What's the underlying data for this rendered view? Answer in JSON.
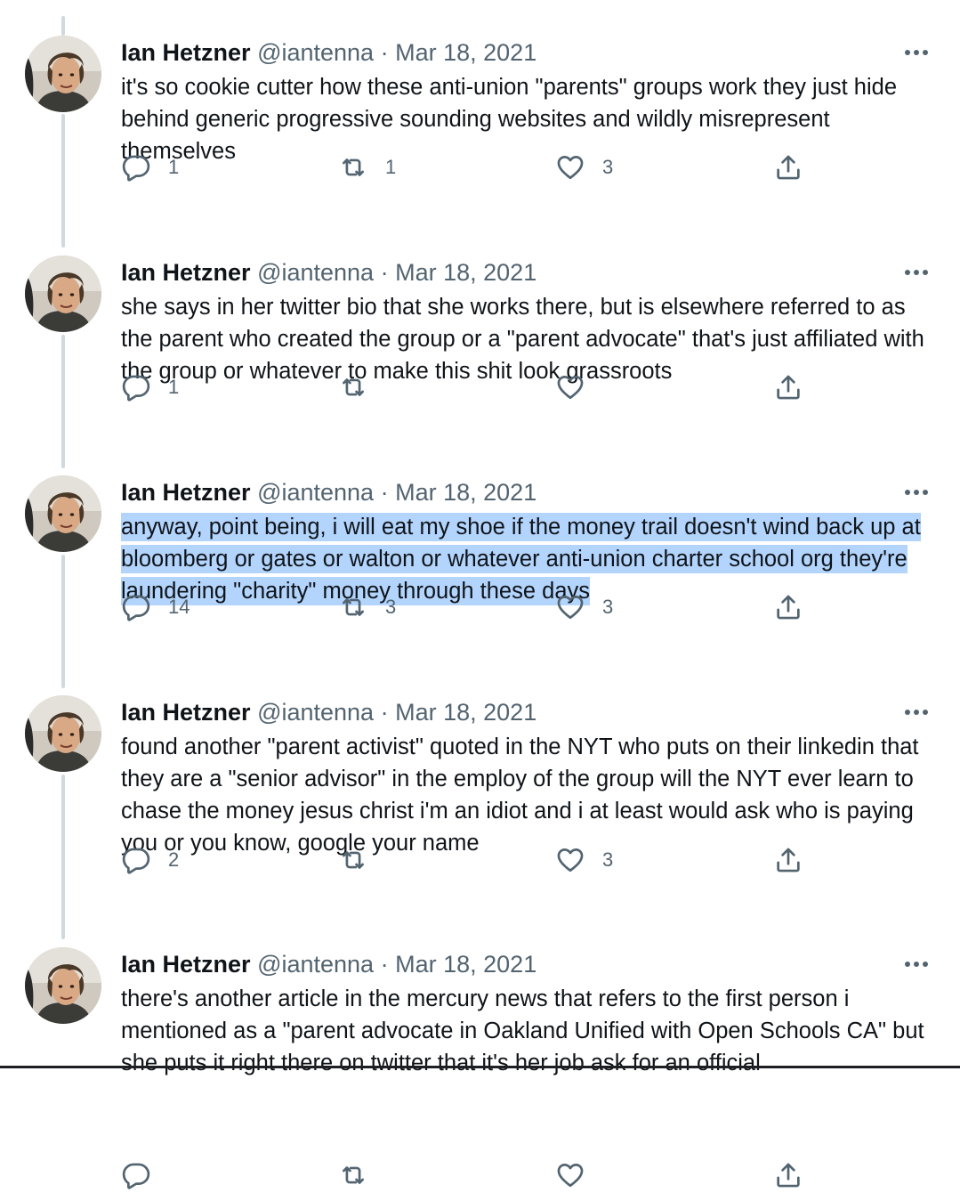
{
  "tweets": [
    {
      "name": "Ian Hetzner",
      "handle": "@iantenna",
      "separator": "·",
      "date": "Mar 18, 2021",
      "text": "it's so cookie cutter how these anti-union \"parents\" groups work they just hide behind generic progressive sounding websites and wildly misrepresent themselves",
      "highlighted": false,
      "replies": "1",
      "retweets": "1",
      "likes": "3"
    },
    {
      "name": "Ian Hetzner",
      "handle": "@iantenna",
      "separator": "·",
      "date": "Mar 18, 2021",
      "text": "she says in her twitter bio that she works there, but is elsewhere referred to as the parent who created the group or a \"parent advocate\" that's just affiliated with the group or whatever to make this shit look grassroots",
      "highlighted": false,
      "replies": "1",
      "retweets": "",
      "likes": ""
    },
    {
      "name": "Ian Hetzner",
      "handle": "@iantenna",
      "separator": "·",
      "date": "Mar 18, 2021",
      "text": "anyway, point being, i will eat my shoe if the money trail doesn't wind back up at bloomberg or gates or walton or whatever anti-union charter school org they're laundering \"charity\" money through these days",
      "highlighted": true,
      "replies": "14",
      "retweets": "3",
      "likes": "3"
    },
    {
      "name": "Ian Hetzner",
      "handle": "@iantenna",
      "separator": "·",
      "date": "Mar 18, 2021",
      "text": "found another \"parent activist\" quoted in the NYT who puts on their linkedin that they are a \"senior advisor\" in the employ of the group will the NYT ever learn to chase the money jesus christ i'm an idiot and i at least would ask who is paying you or you know, google your name",
      "highlighted": false,
      "replies": "2",
      "retweets": "",
      "likes": "3"
    },
    {
      "name": "Ian Hetzner",
      "handle": "@iantenna",
      "separator": "·",
      "date": "Mar 18, 2021",
      "text": "there's another article in the mercury news that refers to the first person i mentioned as a \"parent advocate in Oakland Unified with Open Schools CA\" but she puts it right there on twitter that it's her job ask for an official",
      "highlighted": false,
      "replies": "",
      "retweets": "",
      "likes": ""
    }
  ],
  "icons": {
    "more": "more-icon",
    "reply": "reply-icon",
    "retweet": "retweet-icon",
    "like": "like-icon",
    "share": "share-icon"
  },
  "colors": {
    "text": "#0f1419",
    "secondary": "#536471",
    "thread_line": "#cfd9de",
    "selection": "#b3d4fc"
  }
}
